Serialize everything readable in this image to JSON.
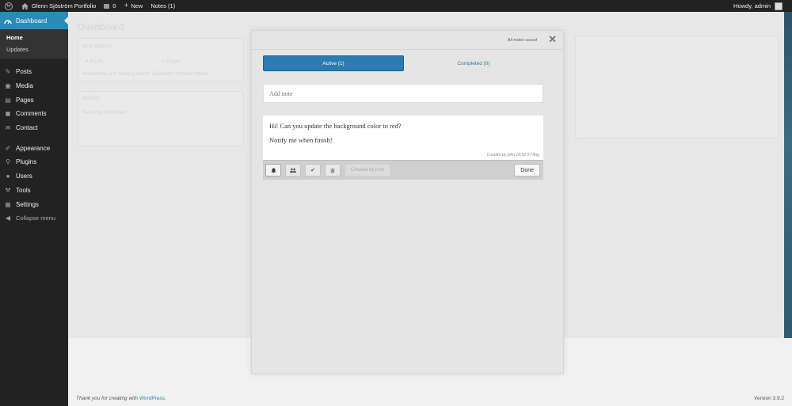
{
  "adminbar": {
    "site_name": "Glenn Sjöström Portfolio",
    "comment_count": "0",
    "new_label": "New",
    "notes_label": "Notes (1)",
    "greeting": "Howdy, admin"
  },
  "sidebar": {
    "dashboard_label": "Dashboard",
    "submenu": [
      "Home",
      "Updates"
    ],
    "items": [
      {
        "label": "Posts",
        "icon": "pin-icon"
      },
      {
        "label": "Media",
        "icon": "media-icon"
      },
      {
        "label": "Pages",
        "icon": "pages-icon"
      },
      {
        "label": "Comments",
        "icon": "comments-icon"
      },
      {
        "label": "Contact",
        "icon": "contact-icon"
      }
    ],
    "items2": [
      {
        "label": "Appearance",
        "icon": "brush-icon"
      },
      {
        "label": "Plugins",
        "icon": "plugin-icon"
      },
      {
        "label": "Users",
        "icon": "user-icon"
      },
      {
        "label": "Tools",
        "icon": "wrench-icon"
      },
      {
        "label": "Settings",
        "icon": "settings-icon"
      }
    ],
    "collapse_label": "Collapse menu"
  },
  "background": {
    "page_title": "Dashboard",
    "glance_title": "At a Glance",
    "glance_posts": "4 Posts",
    "glance_pages": "4 Pages",
    "glance_running": "WordPress 3.9 running Glenn Sjöström Portfolio theme.",
    "activity_title": "Activity",
    "recently_published": "Recently Published"
  },
  "notes_modal": {
    "status": "All notes saved",
    "tabs": {
      "active": "Active (1)",
      "completed": "Completed (0)"
    },
    "add_placeholder": "Add note",
    "note": {
      "line1": "Hi! Can you update the background color to red?",
      "line2": "Notify me when finish!",
      "meta": "Created by john 18:52 07 Aug",
      "created_by_button": "Created by john",
      "done_label": "Done"
    }
  },
  "footer": {
    "thanks_prefix": "Thank you for creating with",
    "thanks_link": "WordPress.",
    "version": "Version 3.9.2"
  },
  "colors": {
    "accent": "#2c7cb1",
    "sidebar_bg": "#222222",
    "menu_active": "#2a8ab8"
  }
}
